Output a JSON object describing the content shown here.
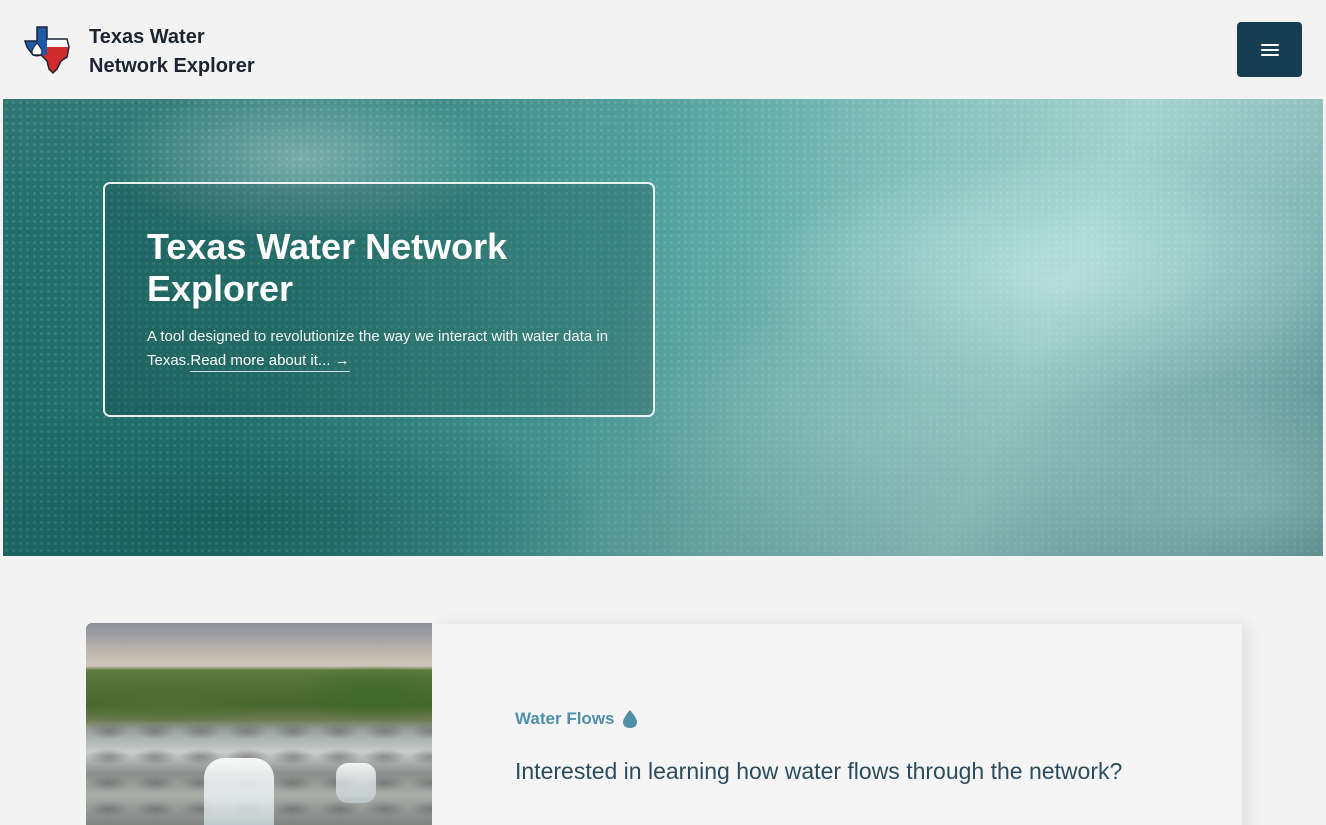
{
  "header": {
    "brand_line1": "Texas Water",
    "brand_line2": "Network Explorer",
    "menu_icon": "hamburger-icon"
  },
  "hero": {
    "title": "Texas Water Network Explorer",
    "description": "A tool designed to revolutionize the way we interact with water data in Texas.",
    "link_label": "Read more about it... →"
  },
  "feature": {
    "label": "Water Flows",
    "label_icon": "water-drop-icon",
    "text": "Interested in learning how water flows through the network?"
  },
  "colors": {
    "header_button": "#163d52",
    "accent_label": "#4f8fa8",
    "hero_teal": "#2a7e78"
  }
}
